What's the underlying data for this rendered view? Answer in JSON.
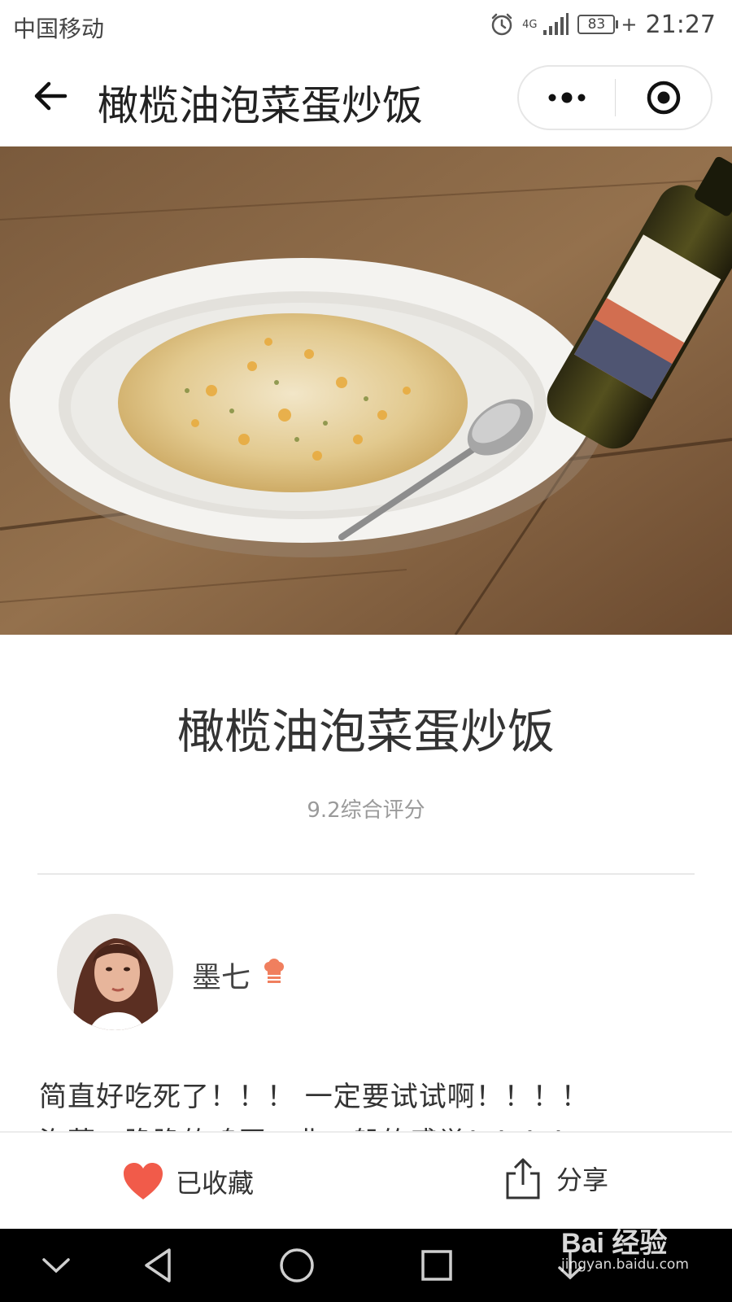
{
  "status_bar": {
    "carrier": "中国移动",
    "network": "4G",
    "battery": "83",
    "time": "21:27",
    "icons": [
      "alarm-icon",
      "signal-icon",
      "battery-icon"
    ]
  },
  "title_bar": {
    "title": "橄榄油泡菜蛋炒饭",
    "back_icon": "back-arrow-icon",
    "more_icon": "more-dots-icon",
    "close_icon": "target-close-icon"
  },
  "recipe": {
    "title": "橄榄油泡菜蛋炒饭",
    "rating": "9.2综合评分",
    "author": {
      "name": "墨七",
      "badge_icon": "chef-hat-icon"
    },
    "description": [
      "简直好吃死了！！！ 一定要试试啊！！！！",
      "泡菜、脆脆的鸡蛋，非一般的感觉！！！！"
    ]
  },
  "actions": {
    "favorite_label": "已收藏",
    "favorite_icon": "heart-icon",
    "share_label": "分享",
    "share_icon": "share-icon"
  },
  "watermark": {
    "logo": "Bai 经验",
    "url": "jingyan.baidu.com"
  },
  "colors": {
    "accent_heart": "#f15b4a",
    "chef_badge": "#f07f5e",
    "nav_background": "#000000"
  }
}
